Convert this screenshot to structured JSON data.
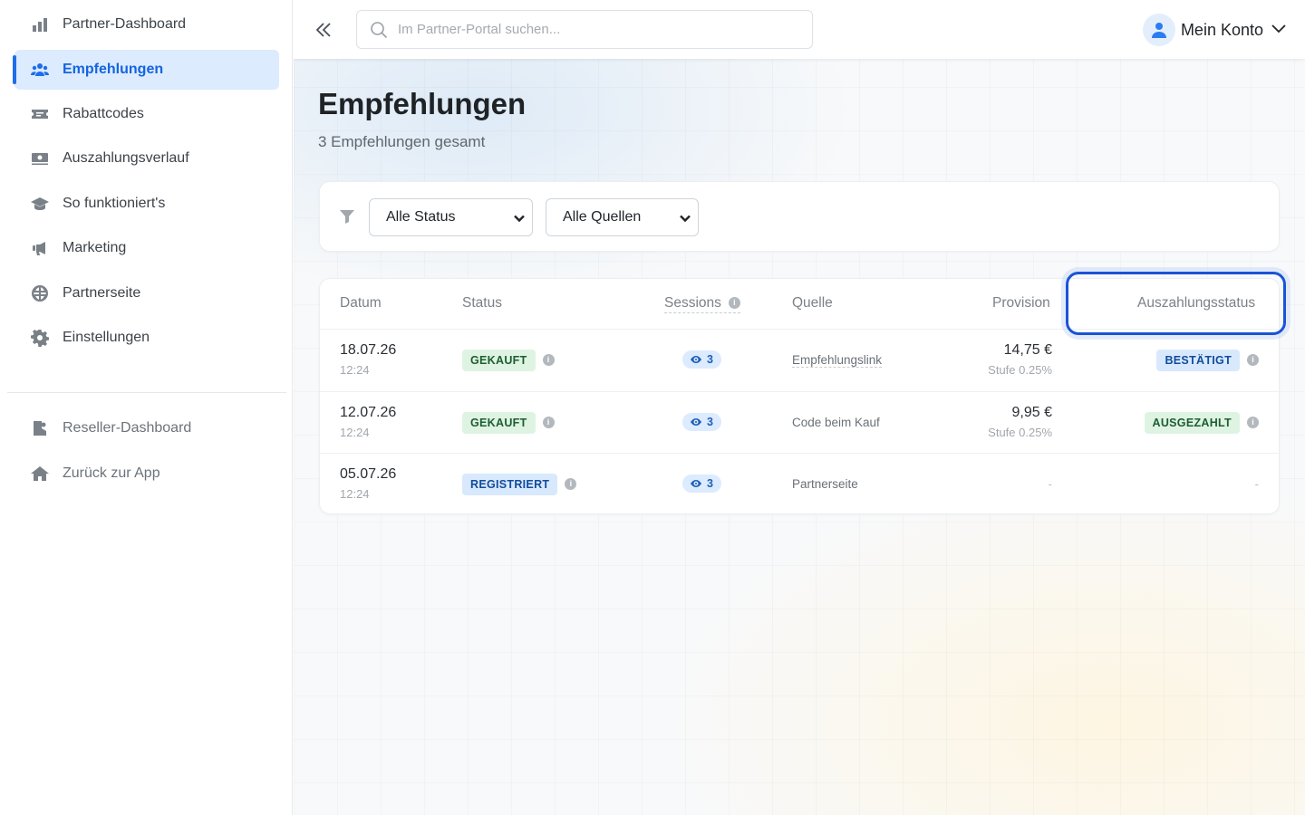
{
  "sidebar": {
    "items": [
      {
        "label": "Partner-Dashboard",
        "icon": "bar-chart-icon"
      },
      {
        "label": "Empfehlungen",
        "icon": "users-icon",
        "active": true
      },
      {
        "label": "Rabattcodes",
        "icon": "ticket-icon"
      },
      {
        "label": "Auszahlungsverlauf",
        "icon": "money-bill-icon"
      },
      {
        "label": "So funktioniert's",
        "icon": "graduation-cap-icon"
      },
      {
        "label": "Marketing",
        "icon": "megaphone-icon"
      },
      {
        "label": "Partnerseite",
        "icon": "globe-icon"
      },
      {
        "label": "Einstellungen",
        "icon": "gear-icon"
      }
    ],
    "secondary": [
      {
        "label": "Reseller-Dashboard",
        "icon": "reseller-icon"
      },
      {
        "label": "Zurück zur App",
        "icon": "home-icon"
      }
    ]
  },
  "topbar": {
    "search_placeholder": "Im Partner-Portal suchen...",
    "account_label": "Mein Konto"
  },
  "page": {
    "title": "Empfehlungen",
    "subtitle": "3 Empfehlungen gesamt"
  },
  "filters": {
    "status": "Alle Status",
    "source": "Alle Quellen"
  },
  "table": {
    "headers": {
      "date": "Datum",
      "status": "Status",
      "sessions": "Sessions",
      "source": "Quelle",
      "commission": "Provision",
      "payout": "Auszahlungsstatus"
    },
    "rows": [
      {
        "date": "18.07.26",
        "time": "12:24",
        "status": "GEKAUFT",
        "sessions": "3",
        "source": "Empfehlungslink",
        "amount": "14,75 €",
        "tier": "Stufe 0.25%",
        "payout": "BESTÄTIGT"
      },
      {
        "date": "12.07.26",
        "time": "12:24",
        "status": "GEKAUFT",
        "sessions": "3",
        "source": "Code beim Kauf",
        "amount": "9,95 €",
        "tier": "Stufe 0.25%",
        "payout": "AUSGEZAHLT"
      },
      {
        "date": "05.07.26",
        "time": "12:24",
        "status": "REGISTRIERT",
        "sessions": "3",
        "source": "Partnerseite",
        "amount": "-",
        "payout": "-"
      }
    ]
  },
  "colors": {
    "accent": "#1d6ee8",
    "active_bg": "#dcebfe",
    "highlight_border": "#1a53d6"
  }
}
